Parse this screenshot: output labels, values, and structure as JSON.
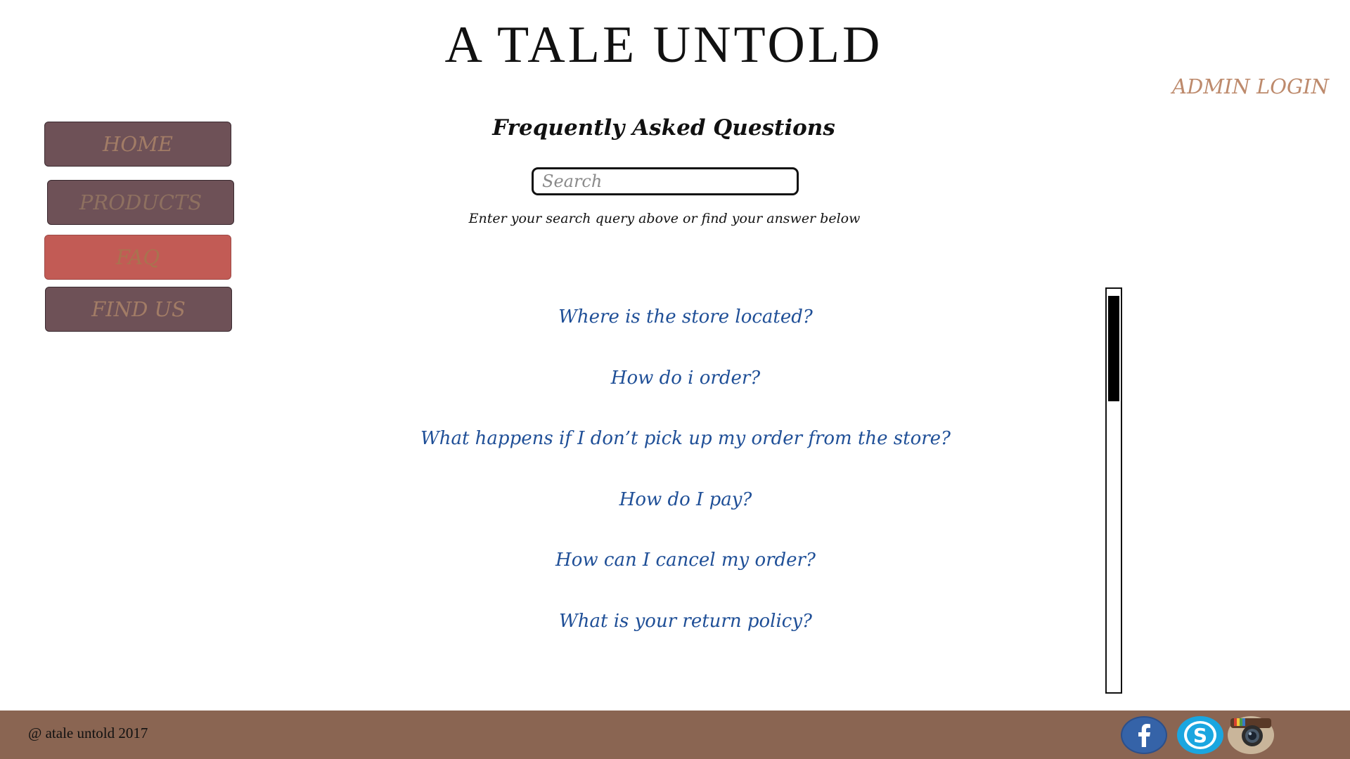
{
  "header": {
    "site_title": "A TALE UNTOLD",
    "admin_login": "ADMIN LOGIN"
  },
  "nav": {
    "items": [
      {
        "label": "HOME"
      },
      {
        "label": "PRODUCTS"
      },
      {
        "label": "FAQ",
        "active": true
      },
      {
        "label": "FIND US"
      }
    ]
  },
  "faq": {
    "heading": "Frequently Asked Questions",
    "search_placeholder": "Search",
    "search_hint": "Enter your search query above or find your answer below",
    "questions": [
      "Where is the store located?",
      "How do i order?",
      "What happens if I don’t pick up my order from the store?",
      "How do I pay?",
      "How can I cancel my order?",
      "What is your return policy?"
    ]
  },
  "footer": {
    "copyright": "@ atale untold 2017",
    "social_icons": [
      "facebook-icon",
      "skype-icon",
      "instagram-icon"
    ]
  },
  "colors": {
    "nav_button": "#6e5157",
    "nav_active": "#c25b55",
    "nav_text": "#a27c66",
    "link_blue": "#1f4f97",
    "admin_login": "#bd8a6c",
    "footer_bg": "#8a6552"
  }
}
